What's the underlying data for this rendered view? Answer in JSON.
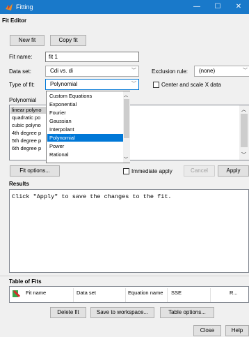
{
  "window": {
    "title": "Fitting",
    "minimize_glyph": "—",
    "maximize_glyph": "☐",
    "close_glyph": "✕",
    "accent_color": "#1979ca"
  },
  "fit_editor": {
    "section_label": "Fit Editor",
    "new_fit_label": "New fit",
    "copy_fit_label": "Copy fit",
    "fit_name_label": "Fit name:",
    "fit_name_value": "fit 1",
    "data_set_label": "Data set:",
    "data_set_value": "Cdi vs. di",
    "exclusion_rule_label": "Exclusion rule:",
    "exclusion_rule_value": "(none)",
    "type_of_fit_label": "Type of fit:",
    "type_of_fit_value": "Polynomial",
    "center_scale_label": "Center and scale X data",
    "center_scale_checked": false,
    "polynomial_label": "Polynomial",
    "polynomial_options": [
      "linear polyno",
      "quadratic po",
      "cubic polyno",
      "4th degree p",
      "5th degree p",
      "6th degree p"
    ],
    "selected_polynomial": "linear polyno"
  },
  "type_dropdown": {
    "options": [
      "Custom Equations",
      "Exponential",
      "Fourier",
      "Gaussian",
      "Interpolant",
      "Polynomial",
      "Power",
      "Rational"
    ],
    "selected": "Polynomial"
  },
  "actions": {
    "fit_options_label": "Fit options...",
    "immediate_apply_label": "Immediate apply",
    "immediate_apply_checked": false,
    "cancel_label": "Cancel",
    "apply_label": "Apply"
  },
  "results": {
    "section_label": "Results",
    "message": "Click \"Apply\" to save the changes to the fit."
  },
  "table_of_fits": {
    "section_label": "Table of Fits",
    "columns": [
      "Fit name",
      "Data set",
      "Equation name",
      "SSE",
      "R..."
    ],
    "delete_fit_label": "Delete fit",
    "save_workspace_label": "Save to workspace...",
    "table_options_label": "Table options..."
  },
  "footer": {
    "close_label": "Close",
    "help_label": "Help"
  }
}
